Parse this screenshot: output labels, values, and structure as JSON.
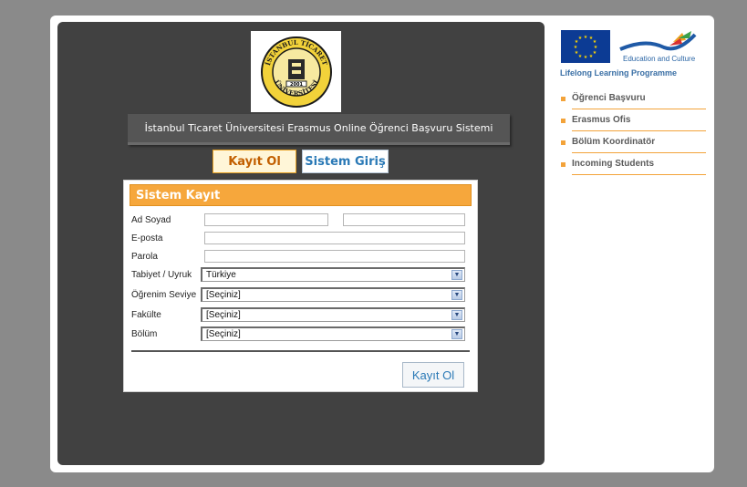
{
  "logo": {
    "top_text": "İSTANBUL TİCARET",
    "bottom_text": "ÜNİVERSİTESİ",
    "year": "2001"
  },
  "header": {
    "title": "İstanbul Ticaret Üniversitesi Erasmus Online Öğrenci Başvuru Sistemi"
  },
  "tabs": {
    "register": "Kayıt Ol",
    "login": "Sistem Giriş"
  },
  "form": {
    "title": "Sistem Kayıt",
    "labels": {
      "name": "Ad Soyad",
      "email": "E-posta",
      "password": "Parola",
      "nationality": "Tabiyet / Uyruk",
      "level": "Öğrenim Seviye",
      "faculty": "Fakülte",
      "department": "Bölüm"
    },
    "values": {
      "first_name": "",
      "last_name": "",
      "email": "",
      "password": "",
      "nationality": "Türkiye",
      "level": "[Seçiniz]",
      "faculty": "[Seçiniz]",
      "department": "[Seçiniz]"
    },
    "submit": "Kayıt Ol"
  },
  "sidebar": {
    "eac_text": "Education and Culture",
    "llp_text": "Lifelong Learning Programme",
    "items": [
      {
        "label": "Öğrenci Başvuru"
      },
      {
        "label": "Erasmus Ofis"
      },
      {
        "label": "Bölüm Koordinatör"
      },
      {
        "label": "Incoming Students"
      }
    ]
  },
  "colors": {
    "accent": "#f6a73c",
    "link_blue": "#2a79b6",
    "panel_dark": "#414141"
  }
}
